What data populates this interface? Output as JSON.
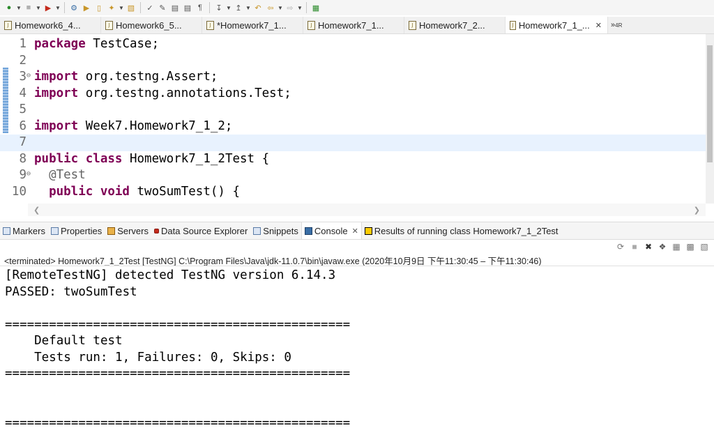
{
  "toolbar": {
    "icons": [
      "debug-run-icon",
      "stop-icon",
      "run-tool-icon",
      "test-icon",
      "open-folder-icon",
      "new-package-icon",
      "search-icon",
      "open-type-icon",
      "pin-icon",
      "pen-icon",
      "format-icon",
      "doc-icon",
      "pilcrow-icon",
      "next-annotation-icon",
      "prev-annotation-icon",
      "back-icon",
      "back-arrow-icon",
      "forward-arrow-icon",
      "perspective-icon"
    ]
  },
  "editor_tabs": [
    {
      "label": "Homework6_4...",
      "active": false
    },
    {
      "label": "Homework6_5...",
      "active": false
    },
    {
      "label": "*Homework7_1...",
      "active": false
    },
    {
      "label": "Homework7_1...",
      "active": false
    },
    {
      "label": "Homework7_2...",
      "active": false
    },
    {
      "label": "Homework7_1_...",
      "active": true,
      "close": "✕"
    }
  ],
  "editor_overflow": {
    "symbol": "»",
    "count": "4R"
  },
  "editor": {
    "lines": [
      {
        "num": "1",
        "keyword": "package",
        "rest": " TestCase;"
      },
      {
        "num": "2",
        "keyword": "",
        "rest": ""
      },
      {
        "num": "3",
        "keyword": "import",
        "rest": " org.testng.Assert;"
      },
      {
        "num": "4",
        "keyword": "import",
        "rest": " org.testng.annotations.Test;"
      },
      {
        "num": "5",
        "keyword": "",
        "rest": ""
      },
      {
        "num": "6",
        "keyword": "import",
        "rest": " Week7.Homework7_1_2;"
      },
      {
        "num": "7",
        "keyword": "",
        "rest": ""
      },
      {
        "num": "8",
        "keyword": "public class",
        "rest": " Homework7_1_2Test {"
      },
      {
        "num": "9",
        "keyword": "",
        "rest": "  @Test"
      },
      {
        "num": "10",
        "keyword": "  public void",
        "rest": " twoSumTest() {"
      }
    ]
  },
  "view_tabs": [
    {
      "label": "Markers",
      "icon": "markers-icon"
    },
    {
      "label": "Properties",
      "icon": "properties-icon"
    },
    {
      "label": "Servers",
      "icon": "servers-icon"
    },
    {
      "label": "Data Source Explorer",
      "icon": "data-source-icon"
    },
    {
      "label": "Snippets",
      "icon": "snippets-icon"
    },
    {
      "label": "Console",
      "icon": "console-icon",
      "active": true,
      "close": "✕"
    },
    {
      "label": "Results of running class Homework7_1_2Test",
      "icon": "testng-icon"
    }
  ],
  "console": {
    "status": "<terminated> Homework7_1_2Test [TestNG] C:\\Program Files\\Java\\jdk-11.0.7\\bin\\javaw.exe  (2020年10月9日 下午11:30:45 – 下午11:30:46)",
    "lines": [
      "[RemoteTestNG] detected TestNG version 6.14.3",
      "PASSED: twoSumTest",
      "",
      "===============================================",
      "    Default test",
      "    Tests run: 1, Failures: 0, Skips: 0",
      "===============================================",
      "",
      "",
      "==============================================="
    ]
  }
}
